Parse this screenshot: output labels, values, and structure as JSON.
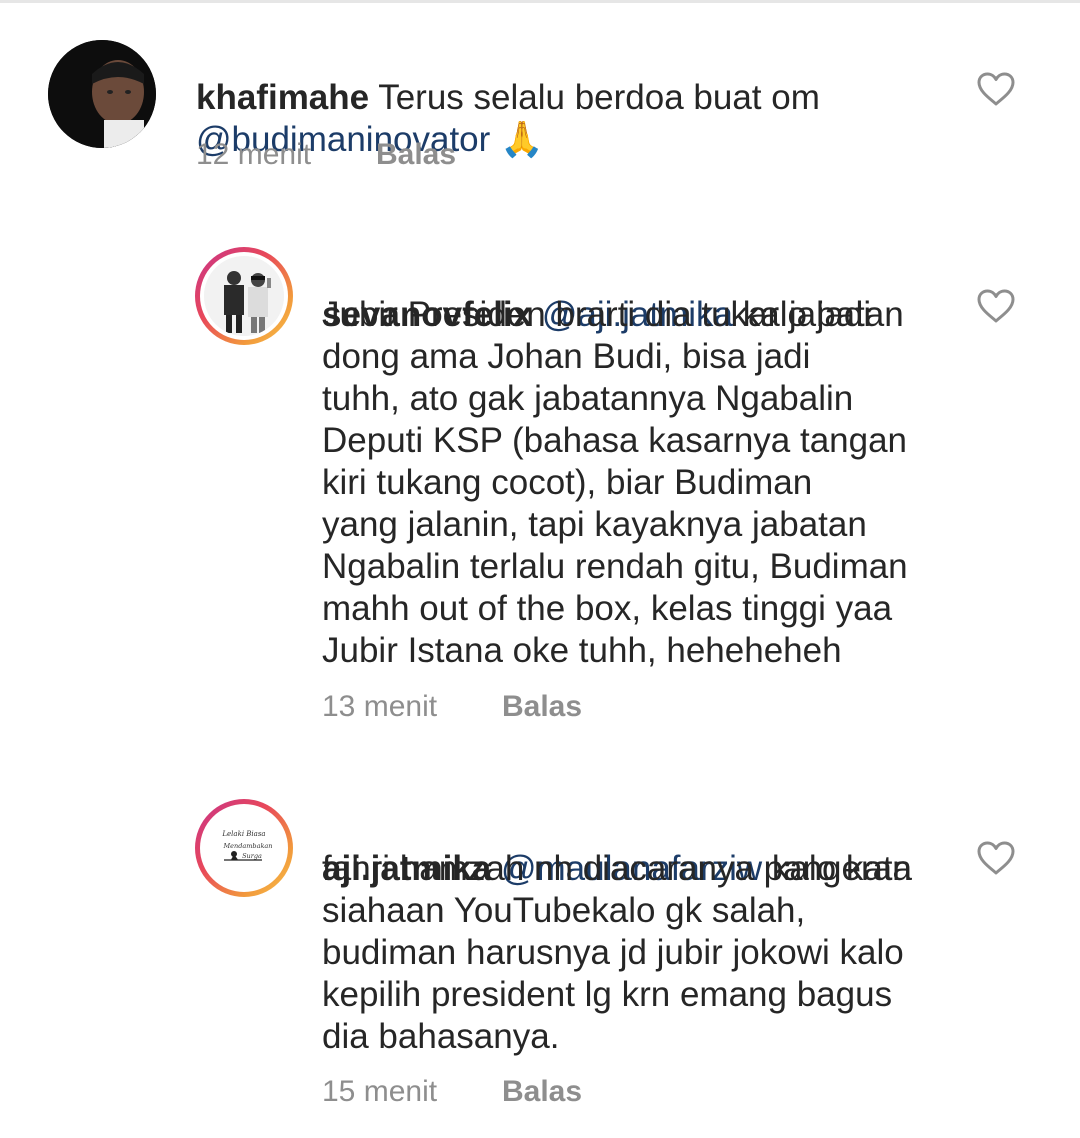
{
  "comments": [
    {
      "username": "khafimahe",
      "mention": "",
      "text_first_line_after_user": " Terus selalu berdoa buat om",
      "text_lines": "",
      "second_line_mention": "@budimaninovator",
      "emoji": "🙏",
      "time": "12 menit",
      "reply_label": "Balas"
    },
    {
      "username": "sevanovfelix",
      "mention": "@aji.jatmika",
      "text_first_line_after_user": " kalo jadi",
      "text_lines": "Jubir Presiden brarti dia tukar jabatan\ndong ama Johan Budi,  bisa jadi\ntuhh,  ato gak jabatannya Ngabalin\nDeputi KSP (bahasa kasarnya tangan\nkiri tukang cocot), biar Budiman\nyang jalanin,  tapi kayaknya jabatan\nNgabalin terlalu rendah gitu,  Budiman\nmahh out of the box,  kelas tinggi yaa\nJubir Istana oke tuhh,  heheheheh",
      "time": "13 menit",
      "reply_label": "Balas"
    },
    {
      "username": "aji.jatmika",
      "mention": "@maulanafarziw",
      "text_first_line_after_user": " kalo kata",
      "text_lines": "fahri hamzah nh diacaranya pangeran\nsiahaan YouTubekalo gk salah,\nbudiman harusnya jd jubir jokowi kalo\nkepilih president lg krn emang bagus\ndia bahasanya.",
      "time": "15 menit",
      "reply_label": "Balas"
    }
  ],
  "avatar_logo_text": [
    "Lelaki Biasa",
    "Yang Mendambakan",
    "Surga"
  ],
  "icons": {
    "like": "heart-outline-icon"
  },
  "colors": {
    "text": "#262626",
    "mention": "#1c3c68",
    "meta": "#8e8e8e",
    "story_ring_start": "#c7338a",
    "story_ring_end": "#f7c24a"
  }
}
